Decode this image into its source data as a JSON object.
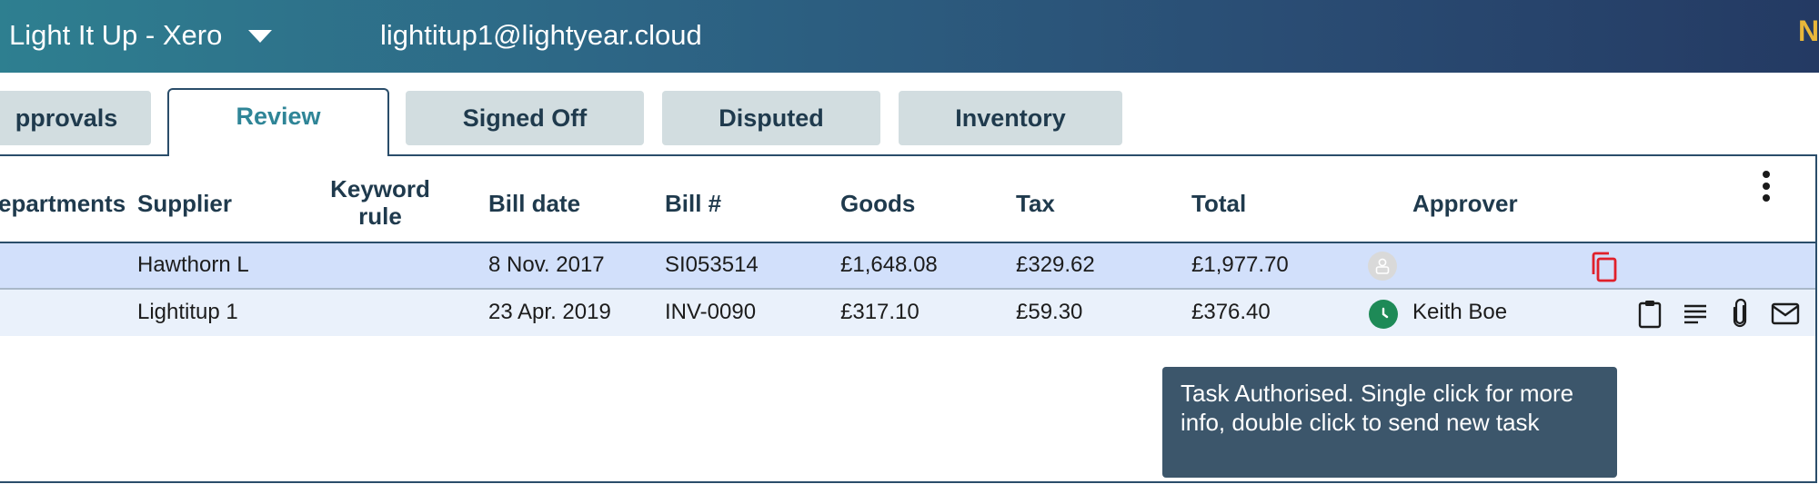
{
  "topbar": {
    "org_name": "Light It Up - Xero",
    "user_email": "lightitup1@lightyear.cloud",
    "corner_badge": "N"
  },
  "tabs": [
    {
      "label": "pprovals",
      "active": false
    },
    {
      "label": "Review",
      "active": true
    },
    {
      "label": "Signed Off",
      "active": false
    },
    {
      "label": "Disputed",
      "active": false
    },
    {
      "label": "Inventory",
      "active": false
    }
  ],
  "table": {
    "headers": {
      "departments": "epartments",
      "supplier": "Supplier",
      "keyword_rule_line1": "Keyword",
      "keyword_rule_line2": "rule",
      "bill_date": "Bill date",
      "bill_number": "Bill #",
      "goods": "Goods",
      "tax": "Tax",
      "total": "Total",
      "approver": "Approver"
    },
    "rows": [
      {
        "supplier": "Hawthorn L",
        "bill_date": "8 Nov. 2017",
        "bill_number": "SI053514",
        "goods": "£1,648.08",
        "tax": "£329.62",
        "total": "£1,977.70",
        "approver": "",
        "status": "pending",
        "selected": true
      },
      {
        "supplier": "Lightitup 1",
        "bill_date": "23 Apr. 2019",
        "bill_number": "INV-0090",
        "goods": "£317.10",
        "tax": "£59.30",
        "total": "£376.40",
        "approver": "Keith Boe",
        "status": "authorised",
        "selected": false
      }
    ]
  },
  "tooltip": {
    "text": "Task Authorised. Single click for more info, double click to send new task"
  },
  "colors": {
    "accent": "#2f8597",
    "header_text": "#1f3a4d",
    "selected_row": "#d2e0fb",
    "row_alt": "#eaf1fb",
    "status_green": "#1e8a57",
    "copy_red": "#e0202a",
    "tooltip_bg": "#3c566b",
    "badge_gold": "#e9b73a"
  },
  "icons": {
    "org_dropdown": "chevron-down-icon",
    "more_menu": "kebab-menu-icon",
    "row1_status": "user-placeholder-icon",
    "row1_action": "copy-icon",
    "row2_status": "clock-icon",
    "row2_actions": [
      "clipboard-icon",
      "notes-icon",
      "attachment-icon",
      "email-icon"
    ]
  }
}
